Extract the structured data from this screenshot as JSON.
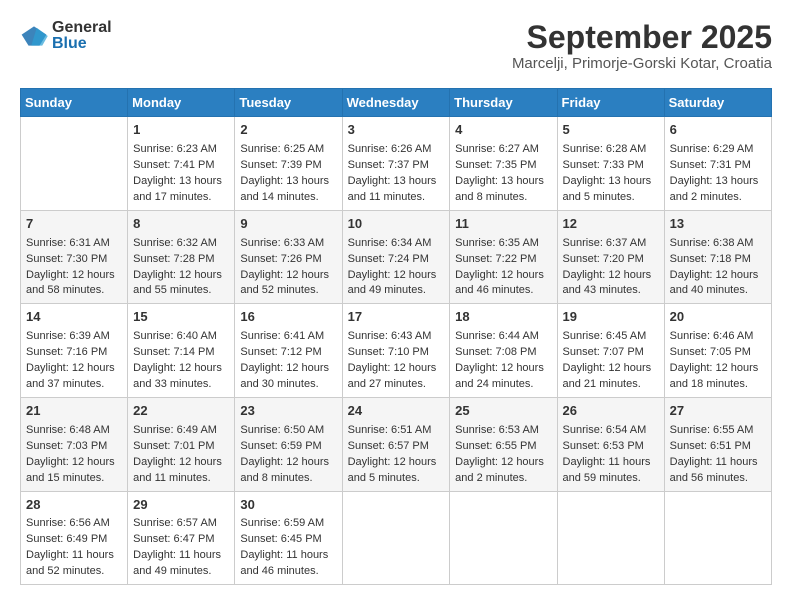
{
  "logo": {
    "general": "General",
    "blue": "Blue"
  },
  "title": "September 2025",
  "subtitle": "Marcelji, Primorje-Gorski Kotar, Croatia",
  "days_of_week": [
    "Sunday",
    "Monday",
    "Tuesday",
    "Wednesday",
    "Thursday",
    "Friday",
    "Saturday"
  ],
  "weeks": [
    [
      {
        "day": "",
        "empty": true
      },
      {
        "day": "1",
        "sunrise": "Sunrise: 6:23 AM",
        "sunset": "Sunset: 7:41 PM",
        "daylight": "Daylight: 13 hours and 17 minutes."
      },
      {
        "day": "2",
        "sunrise": "Sunrise: 6:25 AM",
        "sunset": "Sunset: 7:39 PM",
        "daylight": "Daylight: 13 hours and 14 minutes."
      },
      {
        "day": "3",
        "sunrise": "Sunrise: 6:26 AM",
        "sunset": "Sunset: 7:37 PM",
        "daylight": "Daylight: 13 hours and 11 minutes."
      },
      {
        "day": "4",
        "sunrise": "Sunrise: 6:27 AM",
        "sunset": "Sunset: 7:35 PM",
        "daylight": "Daylight: 13 hours and 8 minutes."
      },
      {
        "day": "5",
        "sunrise": "Sunrise: 6:28 AM",
        "sunset": "Sunset: 7:33 PM",
        "daylight": "Daylight: 13 hours and 5 minutes."
      },
      {
        "day": "6",
        "sunrise": "Sunrise: 6:29 AM",
        "sunset": "Sunset: 7:31 PM",
        "daylight": "Daylight: 13 hours and 2 minutes."
      }
    ],
    [
      {
        "day": "7",
        "sunrise": "Sunrise: 6:31 AM",
        "sunset": "Sunset: 7:30 PM",
        "daylight": "Daylight: 12 hours and 58 minutes."
      },
      {
        "day": "8",
        "sunrise": "Sunrise: 6:32 AM",
        "sunset": "Sunset: 7:28 PM",
        "daylight": "Daylight: 12 hours and 55 minutes."
      },
      {
        "day": "9",
        "sunrise": "Sunrise: 6:33 AM",
        "sunset": "Sunset: 7:26 PM",
        "daylight": "Daylight: 12 hours and 52 minutes."
      },
      {
        "day": "10",
        "sunrise": "Sunrise: 6:34 AM",
        "sunset": "Sunset: 7:24 PM",
        "daylight": "Daylight: 12 hours and 49 minutes."
      },
      {
        "day": "11",
        "sunrise": "Sunrise: 6:35 AM",
        "sunset": "Sunset: 7:22 PM",
        "daylight": "Daylight: 12 hours and 46 minutes."
      },
      {
        "day": "12",
        "sunrise": "Sunrise: 6:37 AM",
        "sunset": "Sunset: 7:20 PM",
        "daylight": "Daylight: 12 hours and 43 minutes."
      },
      {
        "day": "13",
        "sunrise": "Sunrise: 6:38 AM",
        "sunset": "Sunset: 7:18 PM",
        "daylight": "Daylight: 12 hours and 40 minutes."
      }
    ],
    [
      {
        "day": "14",
        "sunrise": "Sunrise: 6:39 AM",
        "sunset": "Sunset: 7:16 PM",
        "daylight": "Daylight: 12 hours and 37 minutes."
      },
      {
        "day": "15",
        "sunrise": "Sunrise: 6:40 AM",
        "sunset": "Sunset: 7:14 PM",
        "daylight": "Daylight: 12 hours and 33 minutes."
      },
      {
        "day": "16",
        "sunrise": "Sunrise: 6:41 AM",
        "sunset": "Sunset: 7:12 PM",
        "daylight": "Daylight: 12 hours and 30 minutes."
      },
      {
        "day": "17",
        "sunrise": "Sunrise: 6:43 AM",
        "sunset": "Sunset: 7:10 PM",
        "daylight": "Daylight: 12 hours and 27 minutes."
      },
      {
        "day": "18",
        "sunrise": "Sunrise: 6:44 AM",
        "sunset": "Sunset: 7:08 PM",
        "daylight": "Daylight: 12 hours and 24 minutes."
      },
      {
        "day": "19",
        "sunrise": "Sunrise: 6:45 AM",
        "sunset": "Sunset: 7:07 PM",
        "daylight": "Daylight: 12 hours and 21 minutes."
      },
      {
        "day": "20",
        "sunrise": "Sunrise: 6:46 AM",
        "sunset": "Sunset: 7:05 PM",
        "daylight": "Daylight: 12 hours and 18 minutes."
      }
    ],
    [
      {
        "day": "21",
        "sunrise": "Sunrise: 6:48 AM",
        "sunset": "Sunset: 7:03 PM",
        "daylight": "Daylight: 12 hours and 15 minutes."
      },
      {
        "day": "22",
        "sunrise": "Sunrise: 6:49 AM",
        "sunset": "Sunset: 7:01 PM",
        "daylight": "Daylight: 12 hours and 11 minutes."
      },
      {
        "day": "23",
        "sunrise": "Sunrise: 6:50 AM",
        "sunset": "Sunset: 6:59 PM",
        "daylight": "Daylight: 12 hours and 8 minutes."
      },
      {
        "day": "24",
        "sunrise": "Sunrise: 6:51 AM",
        "sunset": "Sunset: 6:57 PM",
        "daylight": "Daylight: 12 hours and 5 minutes."
      },
      {
        "day": "25",
        "sunrise": "Sunrise: 6:53 AM",
        "sunset": "Sunset: 6:55 PM",
        "daylight": "Daylight: 12 hours and 2 minutes."
      },
      {
        "day": "26",
        "sunrise": "Sunrise: 6:54 AM",
        "sunset": "Sunset: 6:53 PM",
        "daylight": "Daylight: 11 hours and 59 minutes."
      },
      {
        "day": "27",
        "sunrise": "Sunrise: 6:55 AM",
        "sunset": "Sunset: 6:51 PM",
        "daylight": "Daylight: 11 hours and 56 minutes."
      }
    ],
    [
      {
        "day": "28",
        "sunrise": "Sunrise: 6:56 AM",
        "sunset": "Sunset: 6:49 PM",
        "daylight": "Daylight: 11 hours and 52 minutes."
      },
      {
        "day": "29",
        "sunrise": "Sunrise: 6:57 AM",
        "sunset": "Sunset: 6:47 PM",
        "daylight": "Daylight: 11 hours and 49 minutes."
      },
      {
        "day": "30",
        "sunrise": "Sunrise: 6:59 AM",
        "sunset": "Sunset: 6:45 PM",
        "daylight": "Daylight: 11 hours and 46 minutes."
      },
      {
        "day": "",
        "empty": true
      },
      {
        "day": "",
        "empty": true
      },
      {
        "day": "",
        "empty": true
      },
      {
        "day": "",
        "empty": true
      }
    ]
  ]
}
